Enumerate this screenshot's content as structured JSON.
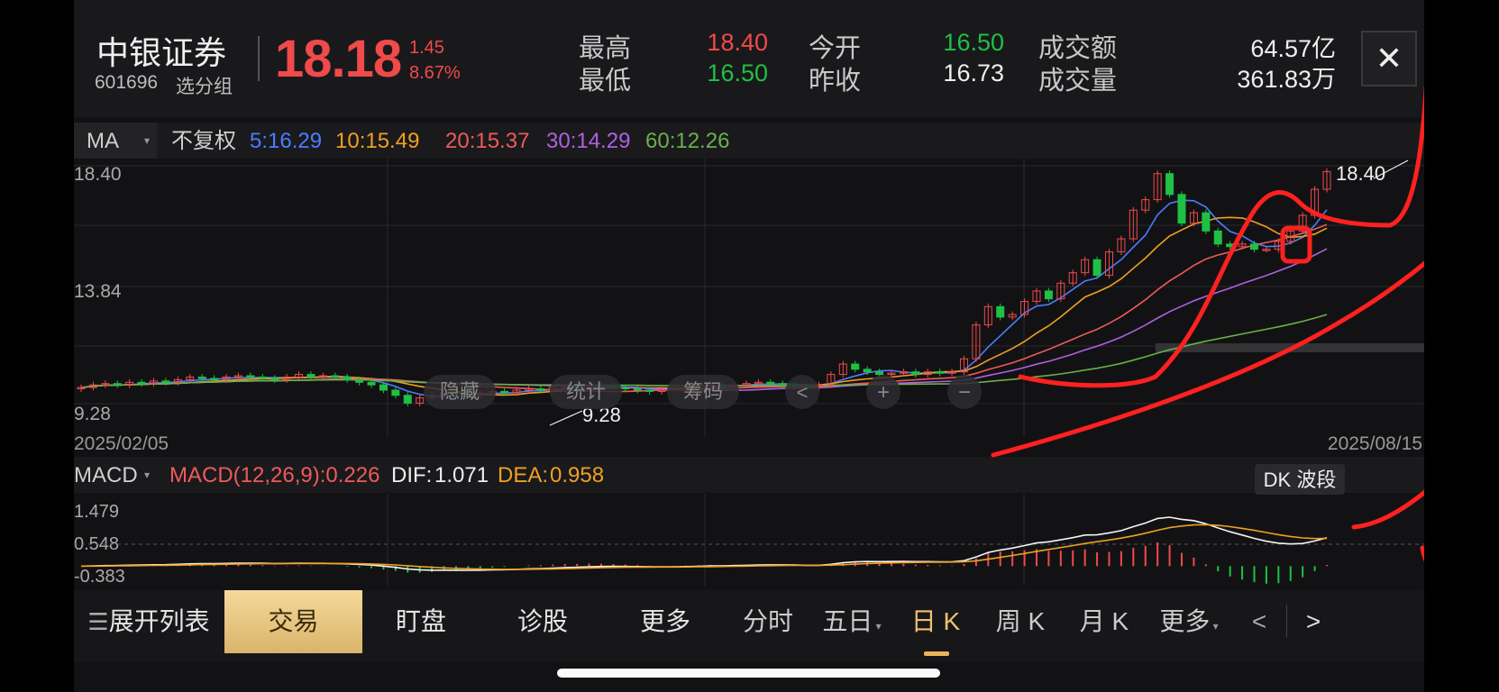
{
  "header": {
    "stock_name": "中银证券",
    "stock_code": "601696",
    "group_label": "选分组",
    "price": "18.18",
    "change": "1.45",
    "change_pct": "8.67%",
    "high_label": "最高",
    "high_value": "18.40",
    "low_label": "最低",
    "low_value": "16.50",
    "open_label": "今开",
    "open_value": "16.50",
    "prev_close_label": "昨收",
    "prev_close_value": "16.73",
    "turnover_label": "成交额",
    "turnover_value": "64.57亿",
    "volume_label": "成交量",
    "volume_value": "361.83万",
    "close_icon": "close-icon"
  },
  "ma_bar": {
    "indicator": "MA",
    "adjust": "不复权",
    "ma5": "5:16.29",
    "ma10": "10:15.49",
    "ma20": "20:15.37",
    "ma30": "30:14.29",
    "ma60": "60:12.26"
  },
  "colors": {
    "up": "#f04a4a",
    "down": "#1fc043",
    "ma5": "#4a7dff",
    "ma10": "#f0a020",
    "ma20": "#ee5a5a",
    "ma30": "#b060e0",
    "ma60": "#6ab04a",
    "annotation": "#ff2020"
  },
  "price_chart": {
    "y_top_label": "18.40",
    "y_mid_label": "13.84",
    "y_bottom_label": "9.28",
    "start_date": "2025/02/05",
    "end_date": "2025/08/15",
    "max_annotation": "18.40",
    "min_annotation": "9.28",
    "overlay_buttons": [
      "隐藏",
      "统计",
      "筹码",
      "<",
      "+",
      "−"
    ]
  },
  "macd": {
    "indicator": "MACD",
    "macd_text": "MACD(12,26,9):0.226",
    "dif_label": "DIF:",
    "dif_value": "1.071",
    "dea_label": "DEA:",
    "dea_value": "0.958",
    "dk_button": "DK 波段",
    "y_labels": [
      "1.479",
      "0.548",
      "-0.383"
    ]
  },
  "bottom_bar": {
    "expand_list": "展开列表",
    "trade": "交易",
    "watch": "盯盘",
    "diagnose": "诊股",
    "more1": "更多",
    "intraday": "分时",
    "five_day": "五日",
    "daily_k": "日 K",
    "weekly_k": "周 K",
    "monthly_k": "月 K",
    "more2": "更多",
    "prev": "<",
    "next": ">"
  },
  "chart_data": {
    "type": "candlestick",
    "x_range": [
      "2025/02/05",
      "2025/08/15"
    ],
    "ylim": [
      9.28,
      18.4
    ],
    "ma": {
      "MA5": 16.29,
      "MA10": 15.49,
      "MA20": 15.37,
      "MA30": 14.29,
      "MA60": 12.26
    },
    "candles_close": [
      9.9,
      10.0,
      10.05,
      10.0,
      10.1,
      10.05,
      10.15,
      10.1,
      10.2,
      10.3,
      10.25,
      10.2,
      10.3,
      10.35,
      10.3,
      10.25,
      10.2,
      10.3,
      10.4,
      10.3,
      10.35,
      10.3,
      10.2,
      10.1,
      10.0,
      9.8,
      9.6,
      9.3,
      9.5,
      9.6,
      9.7,
      9.65,
      9.6,
      9.7,
      9.75,
      9.7,
      9.8,
      9.85,
      9.8,
      9.9,
      9.95,
      9.9,
      10.0,
      9.95,
      9.9,
      9.85,
      9.8,
      9.75,
      9.8,
      9.85,
      9.9,
      9.95,
      10.0,
      9.95,
      10.0,
      10.05,
      10.1,
      10.05,
      10.0,
      9.95,
      9.9,
      10.0,
      10.4,
      10.8,
      10.6,
      10.5,
      10.4,
      10.45,
      10.5,
      10.4,
      10.5,
      10.45,
      10.5,
      11.0,
      12.3,
      13.0,
      12.6,
      12.7,
      13.2,
      13.6,
      13.3,
      13.9,
      14.3,
      14.8,
      14.2,
      15.1,
      15.6,
      16.7,
      17.1,
      18.1,
      17.3,
      16.2,
      16.6,
      15.9,
      15.4,
      15.3,
      15.4,
      15.2,
      15.2,
      15.5,
      15.9,
      16.5,
      17.5,
      18.18
    ],
    "macd_ylim": [
      -0.383,
      1.479
    ],
    "macd_latest": {
      "MACD": 0.226,
      "DIF": 1.071,
      "DEA": 0.958
    }
  }
}
